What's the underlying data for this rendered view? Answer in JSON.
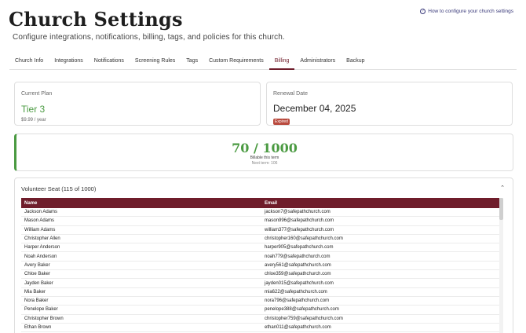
{
  "header": {
    "title": "Church Settings",
    "subtitle": "Configure integrations, notifications, billing, tags, and policies for this church.",
    "help_link": "How to configure your church settings"
  },
  "tabs": [
    {
      "label": "Church Info"
    },
    {
      "label": "Integrations"
    },
    {
      "label": "Notifications"
    },
    {
      "label": "Screening Rules"
    },
    {
      "label": "Tags"
    },
    {
      "label": "Custom Requirements"
    },
    {
      "label": "Billing",
      "active": true
    },
    {
      "label": "Administrators"
    },
    {
      "label": "Backup"
    }
  ],
  "plan": {
    "label": "Current Plan",
    "tier": "Tier 3",
    "price": "$9.99 / year"
  },
  "renewal": {
    "label": "Renewal Date",
    "date": "December 04, 2025",
    "status": "Expired"
  },
  "seats": {
    "count": "70 / 1000",
    "subtitle": "Billable this term",
    "next_term": "Next term: 106"
  },
  "volunteers": {
    "header": "Volunteer Seat (115 of 1000)",
    "columns": [
      "Name",
      "Email"
    ],
    "rows": [
      [
        "Jackson Adams",
        "jackson7@safepathchurch.com"
      ],
      [
        "Mason Adams",
        "mason996@safepathchurch.com"
      ],
      [
        "William Adams",
        "william377@safepathchurch.com"
      ],
      [
        "Christopher Allen",
        "christopher160@safepathchurch.com"
      ],
      [
        "Harper Anderson",
        "harper905@safepathchurch.com"
      ],
      [
        "Noah Anderson",
        "noah779@safepathchurch.com"
      ],
      [
        "Avery Baker",
        "avery561@safepathchurch.com"
      ],
      [
        "Chloe Baker",
        "chloe359@safepathchurch.com"
      ],
      [
        "Jayden Baker",
        "jayden015@safepathchurch.com"
      ],
      [
        "Mia Baker",
        "mia622@safepathchurch.com"
      ],
      [
        "Nora Baker",
        "nora796@safepathchurch.com"
      ],
      [
        "Penelope Baker",
        "penelope388@safepathchurch.com"
      ],
      [
        "Christopher Brown",
        "christopher759@safepathchurch.com"
      ],
      [
        "Ethan Brown",
        "ethan011@safepathchurch.com"
      ]
    ]
  },
  "colors": {
    "accent": "#6f1d2b",
    "success": "#4a9a41",
    "danger": "#b94a3e"
  }
}
